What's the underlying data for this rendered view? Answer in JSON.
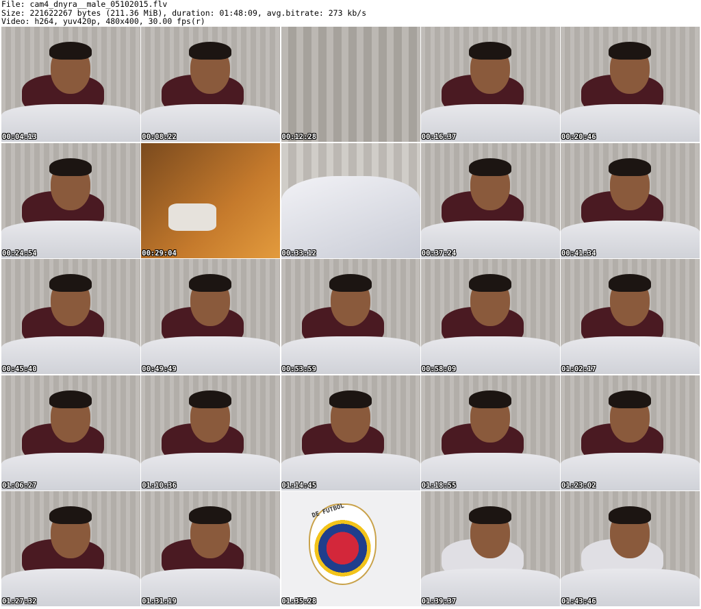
{
  "header": {
    "file_line": "File: cam4_dnyra__male_05102015.flv",
    "size_line": "Size: 221622267 bytes (211.36 MiB), duration: 01:48:09, avg.bitrate: 273 kb/s",
    "video_line": "Video: h264, yuv420p, 480x400, 30.00 fps(r)"
  },
  "thumbnails": [
    {
      "time": "00:04:13"
    },
    {
      "time": "00:08:22"
    },
    {
      "time": "00:12:28"
    },
    {
      "time": "00:16:37"
    },
    {
      "time": "00:20:46"
    },
    {
      "time": "00:24:54"
    },
    {
      "time": "00:29:04"
    },
    {
      "time": "00:33:12"
    },
    {
      "time": "00:37:24"
    },
    {
      "time": "00:41:34"
    },
    {
      "time": "00:45:40"
    },
    {
      "time": "00:49:49"
    },
    {
      "time": "00:53:59"
    },
    {
      "time": "00:58:09"
    },
    {
      "time": "01:02:17"
    },
    {
      "time": "01:06:27"
    },
    {
      "time": "01:10:36"
    },
    {
      "time": "01:14:45"
    },
    {
      "time": "01:18:55"
    },
    {
      "time": "01:23:02"
    },
    {
      "time": "01:27:32"
    },
    {
      "time": "01:31:19"
    },
    {
      "time": "01:35:28"
    },
    {
      "time": "01:39:37"
    },
    {
      "time": "01:43:46"
    }
  ],
  "crest_text": "DE FUTBOL"
}
